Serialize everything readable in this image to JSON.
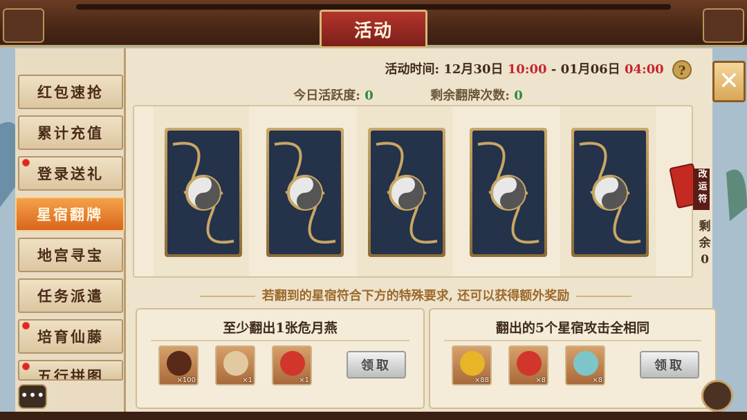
{
  "window": {
    "title": "活动"
  },
  "sidebar": {
    "items": [
      {
        "label": "红包速抢",
        "badge": false,
        "active": false
      },
      {
        "label": "累计充值",
        "badge": false,
        "active": false
      },
      {
        "label": "登录送礼",
        "badge": true,
        "active": false
      },
      {
        "label": "星宿翻牌",
        "badge": false,
        "active": true
      },
      {
        "label": "地宫寻宝",
        "badge": false,
        "active": false
      },
      {
        "label": "任务派遣",
        "badge": false,
        "active": false
      },
      {
        "label": "培育仙藤",
        "badge": true,
        "active": false
      },
      {
        "label": "五行拼图",
        "badge": true,
        "active": false
      }
    ]
  },
  "header": {
    "time_label": "活动时间:",
    "start_date": "12月30日",
    "start_time": "10:00",
    "separator": "-",
    "end_date": "01月06日",
    "end_time": "04:00",
    "help": "?"
  },
  "stats": {
    "activity_label": "今日活跃度:",
    "activity_value": "0",
    "flips_label": "剩余翻牌次数:",
    "flips_value": "0"
  },
  "cards": {
    "count": 5,
    "icon": "yin-yang-icon"
  },
  "fortune": {
    "label": "改运符",
    "remain_label": "剩余",
    "remain_value": "0"
  },
  "hint": "若翻到的星宿符合下方的特殊要求, 还可以获得额外奖励",
  "rewards": [
    {
      "title": "至少翻出1张危月燕",
      "items": [
        {
          "icon": "scroll-icon",
          "count": "×100"
        },
        {
          "icon": "money-bag-icon",
          "count": "×1"
        },
        {
          "icon": "red-pouch-icon",
          "count": "×1"
        }
      ],
      "claim": "领取"
    },
    {
      "title": "翻出的5个星宿攻击全相同",
      "items": [
        {
          "icon": "gold-ingot-icon",
          "count": "×88"
        },
        {
          "icon": "red-pouch-icon",
          "count": "×8"
        },
        {
          "icon": "spirit-orb-icon",
          "count": "×8"
        }
      ],
      "claim": "领取"
    }
  ],
  "colors": {
    "accent": "#d9651c",
    "red_text": "#c3272e",
    "green_text": "#2f8a3a"
  }
}
